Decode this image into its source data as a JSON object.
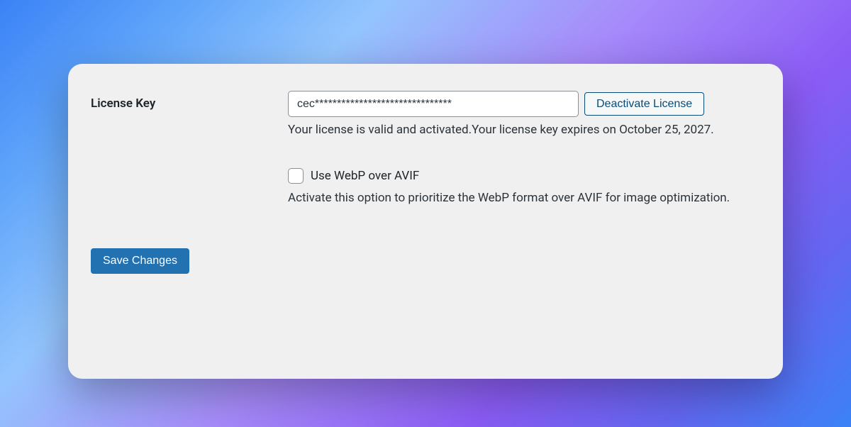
{
  "license": {
    "label": "License Key",
    "value": "cec*******************************",
    "deactivate_label": "Deactivate License",
    "status_text": "Your license is valid and activated.Your license key expires on October 25, 2027."
  },
  "webp_option": {
    "checkbox_label": "Use WebP over AVIF",
    "description": "Activate this option to prioritize the WebP format over AVIF for image optimization."
  },
  "buttons": {
    "save_label": "Save Changes"
  }
}
